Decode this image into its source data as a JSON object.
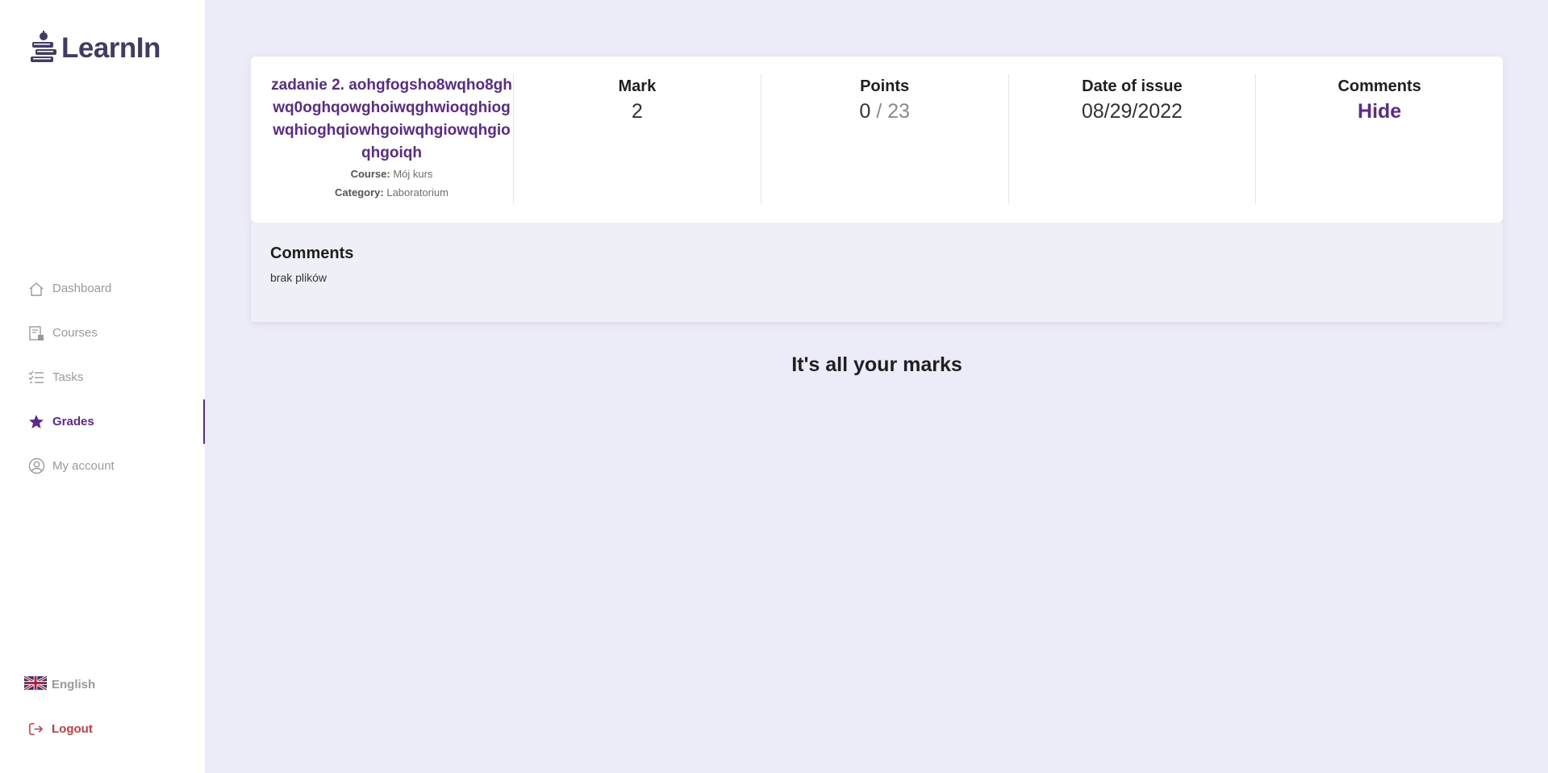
{
  "app": {
    "name": "LearnIn"
  },
  "sidebar": {
    "items": [
      {
        "label": "Dashboard",
        "icon": "home-icon",
        "active": false
      },
      {
        "label": "Courses",
        "icon": "courses-icon",
        "active": false
      },
      {
        "label": "Tasks",
        "icon": "tasks-icon",
        "active": false
      },
      {
        "label": "Grades",
        "icon": "star-icon",
        "active": true
      },
      {
        "label": "My account",
        "icon": "user-circle-icon",
        "active": false
      }
    ],
    "language": {
      "label": "English",
      "icon": "uk-flag-icon"
    },
    "logout": {
      "label": "Logout",
      "icon": "logout-icon"
    }
  },
  "grade": {
    "task_title": "zadanie 2. aohgfogsho8wqho8ghwq0oghqowghoiwqghwioqghiogwqhioghqiowhgoiwqhgiowqhgioqhgoiqh",
    "course_label": "Course:",
    "course_value": "Mój kurs",
    "category_label": "Category:",
    "category_value": "Laboratorium",
    "mark_header": "Mark",
    "mark_value": "2",
    "points_header": "Points",
    "points_value": "0",
    "points_max": "/ 23",
    "date_header": "Date of issue",
    "date_value": "08/29/2022",
    "comments_header": "Comments",
    "comments_toggle": "Hide"
  },
  "comments_panel": {
    "title": "Comments",
    "text": "brak plików"
  },
  "footer_message": "It's all your marks",
  "colors": {
    "accent": "#5c2a8c",
    "background": "#ecebf8",
    "logout": "#d0393e"
  }
}
